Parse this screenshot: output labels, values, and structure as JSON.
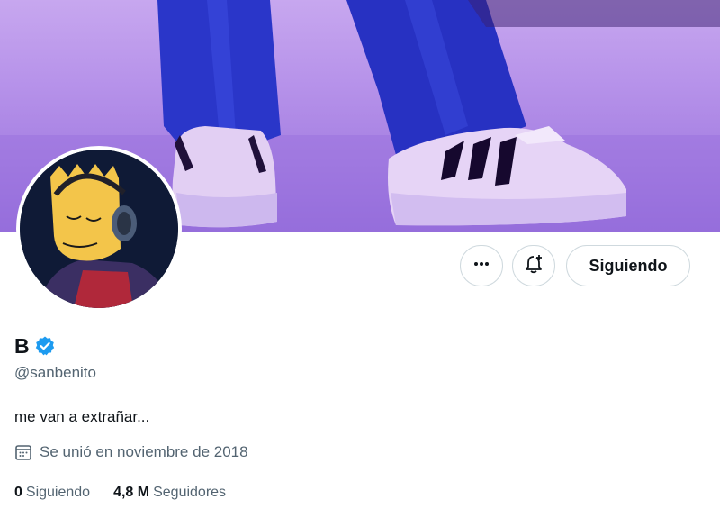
{
  "profile": {
    "display_name": "B",
    "handle": "@sanbenito",
    "bio": "me van a extrañar...",
    "joined": "Se unió en noviembre de 2018",
    "verified": true
  },
  "actions": {
    "more_icon": "ellipsis-icon",
    "notify_icon": "bell-plus-icon",
    "following_label": "Siguiendo"
  },
  "stats": {
    "following_count": "0",
    "following_label": "Siguiendo",
    "followers_count": "4,8 M",
    "followers_label": "Seguidores"
  },
  "colors": {
    "verified_blue": "#1d9bf0",
    "secondary_text": "#536471",
    "primary_text": "#0f1419",
    "border": "#cfd9de"
  }
}
